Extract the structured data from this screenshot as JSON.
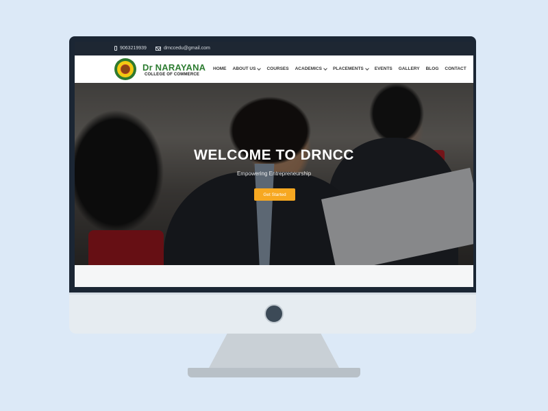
{
  "topbar": {
    "phone": "9063219939",
    "email": "drnccedu@gmail.com"
  },
  "brand": {
    "name": "Dr NARAYANA",
    "subtitle": "COLLEGE OF COMMERCE"
  },
  "nav": {
    "items": [
      {
        "label": "HOME",
        "has_dropdown": false
      },
      {
        "label": "ABOUT US",
        "has_dropdown": true
      },
      {
        "label": "COURSES",
        "has_dropdown": false
      },
      {
        "label": "ACADEMICS",
        "has_dropdown": true
      },
      {
        "label": "PLACEMENTS",
        "has_dropdown": true
      },
      {
        "label": "EVENTS",
        "has_dropdown": false
      },
      {
        "label": "GALLERY",
        "has_dropdown": false
      },
      {
        "label": "BLOG",
        "has_dropdown": false
      },
      {
        "label": "CONTACT",
        "has_dropdown": false
      }
    ]
  },
  "hero": {
    "title": "WELCOME TO DRNCC",
    "subtitle": "Empowering Entrepreneurship",
    "cta_label": "Get Started"
  },
  "colors": {
    "page_background": "#dce9f7",
    "topbar": "#1e2733",
    "brand_green": "#2e7d32",
    "cta": "#f7a821",
    "monitor_bezel": "#1b2634"
  },
  "icons": [
    "phone-icon",
    "mail-icon",
    "college-logo",
    "chevron-down-icon"
  ]
}
